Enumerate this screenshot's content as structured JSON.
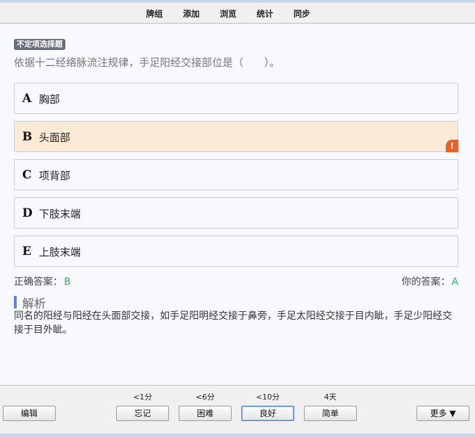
{
  "menu": {
    "items": [
      "牌组",
      "添加",
      "浏览",
      "统计",
      "同步"
    ]
  },
  "question": {
    "type_badge": "不定项选择题",
    "stem": "依据十二经络脉流注规律，手足阳经交接部位是（　　）。"
  },
  "options": [
    {
      "letter": "A",
      "text": "胸部",
      "selected": false
    },
    {
      "letter": "B",
      "text": "头面部",
      "selected": true
    },
    {
      "letter": "C",
      "text": "项背部",
      "selected": false
    },
    {
      "letter": "D",
      "text": "下肢末端",
      "selected": false
    },
    {
      "letter": "E",
      "text": "上肢末端",
      "selected": false
    }
  ],
  "warn_icon": "!",
  "answers": {
    "correct_label": "正确答案：",
    "correct_value": "B",
    "yours_label": "你的答案：",
    "yours_value": "A"
  },
  "analysis": {
    "title": "解析",
    "text": "同名的阳经与阳经在头面部交接，如手足阳明经交接于鼻旁，手足太阳经交接于目内眦，手足少阳经交接于目外眦。"
  },
  "bottom": {
    "edit": "编辑",
    "more": "更多 ▼",
    "intervals": [
      "<1分",
      "<6分",
      "<10分",
      "4天"
    ],
    "ease_buttons": [
      "忘记",
      "困难",
      "良好",
      "简单"
    ]
  },
  "colors": {
    "selected_bg": "#fbebd6",
    "warn": "#e8612c",
    "answer_green": "#33b36b",
    "analysis_accent": "#5b7ee8"
  }
}
